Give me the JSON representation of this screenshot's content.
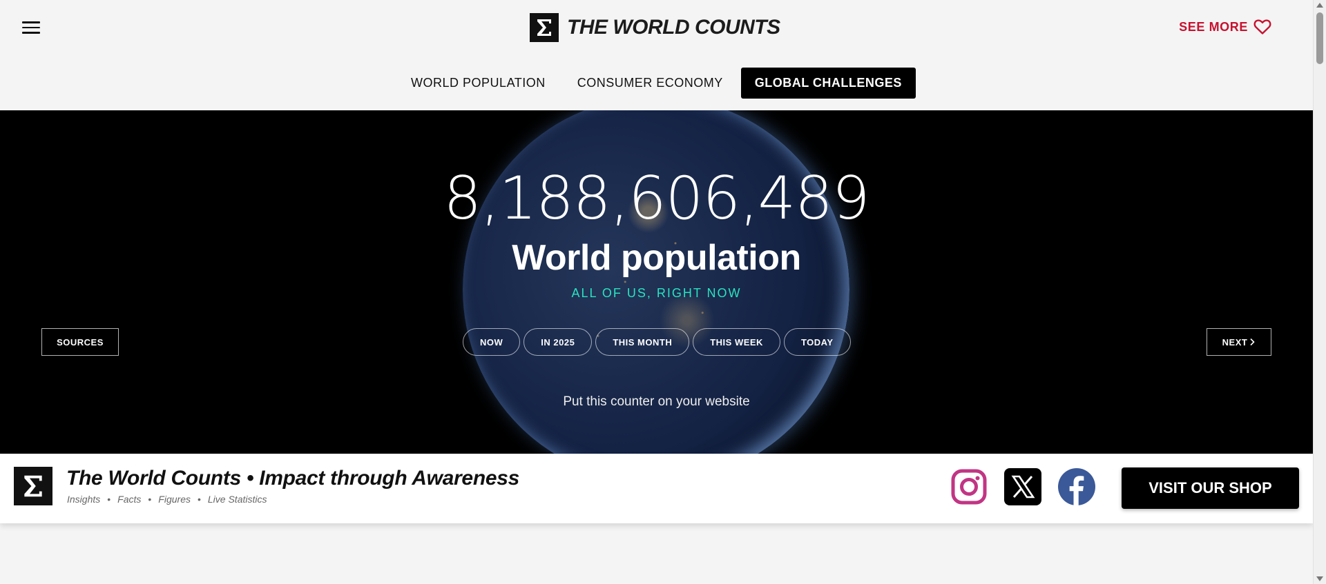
{
  "header": {
    "brand_name": "THE WORLD COUNTS",
    "see_more_label": "SEE MORE",
    "nav_tabs": [
      {
        "label": "WORLD POPULATION",
        "active": false
      },
      {
        "label": "CONSUMER ECONOMY",
        "active": false
      },
      {
        "label": "GLOBAL CHALLENGES",
        "active": true
      }
    ]
  },
  "hero": {
    "counter_value": "8,188,606,489",
    "title": "World population",
    "subtitle": "ALL OF US, RIGHT NOW",
    "sources_label": "SOURCES",
    "next_label": "NEXT",
    "time_pills": [
      "NOW",
      "IN 2025",
      "THIS MONTH",
      "THIS WEEK",
      "TODAY"
    ],
    "embed_text": "Put this counter on your website"
  },
  "footer_bar": {
    "title": "The World Counts • Impact through Awareness",
    "tags": [
      "Insights",
      "Facts",
      "Figures",
      "Live Statistics"
    ],
    "shop_label": "VISIT OUR SHOP",
    "social_icons": [
      "instagram-icon",
      "x-icon",
      "facebook-icon"
    ]
  },
  "colors": {
    "accent_red": "#c8102e",
    "accent_teal": "#29e3c0",
    "instagram": "#c13584",
    "facebook": "#3b5998"
  }
}
